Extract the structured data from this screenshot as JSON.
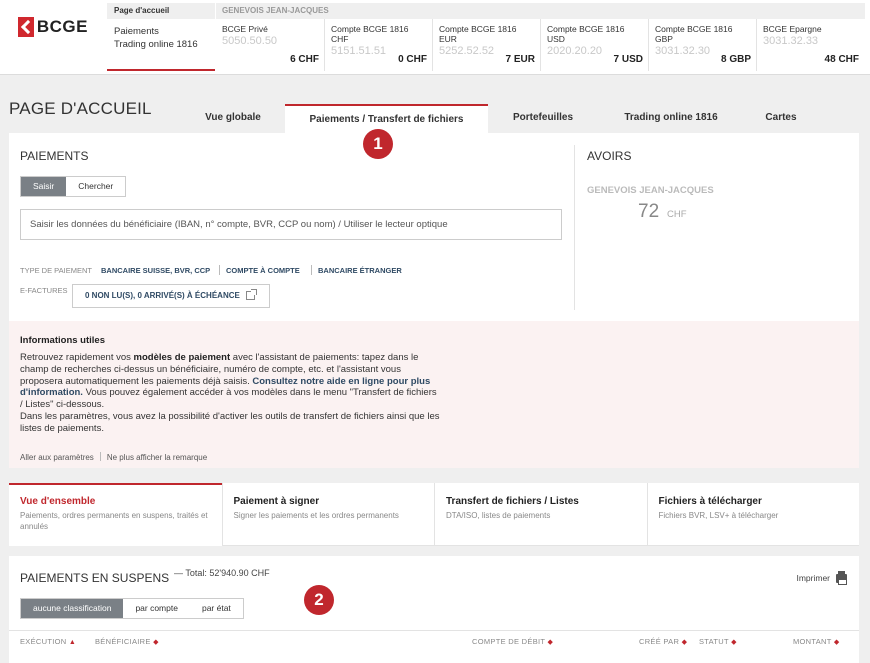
{
  "header": {
    "logo_text": "BCGE",
    "home": {
      "label": "Page d'accueil",
      "line1": "Paiements",
      "line2": "Trading online 1816"
    },
    "owner": "GENEVOIS JEAN-JACQUES",
    "accounts": [
      {
        "name": "BCGE Privé",
        "number": "5050.50.50",
        "amount": "6 CHF"
      },
      {
        "name": "Compte BCGE 1816 CHF",
        "number": "5151.51.51",
        "amount": "0 CHF"
      },
      {
        "name": "Compte BCGE 1816 EUR",
        "number": "5252.52.52",
        "amount": "7 EUR"
      },
      {
        "name": "Compte BCGE 1816 USD",
        "number": "2020.20.20",
        "amount": "7 USD"
      },
      {
        "name": "Compte BCGE 1816 GBP",
        "number": "3031.32.30",
        "amount": "8 GBP"
      },
      {
        "name": "BCGE Epargne",
        "number": "3031.32.33",
        "amount": "48 CHF"
      }
    ]
  },
  "page": {
    "title": "PAGE D'ACCUEIL"
  },
  "tabs": [
    {
      "label": "Vue globale"
    },
    {
      "label": "Paiements / Transfert de fichiers"
    },
    {
      "label": "Portefeuilles"
    },
    {
      "label": "Trading online 1816"
    },
    {
      "label": "Cartes"
    }
  ],
  "badges": {
    "one": "1",
    "two": "2"
  },
  "payments": {
    "title": "PAIEMENTS",
    "btn_enter": "Saisir",
    "btn_search": "Chercher",
    "search_placeholder": "Saisir les données du bénéficiaire (IBAN, n° compte, BVR, CCP ou nom) / Utiliser le lecteur optique",
    "type_label": "TYPE DE PAIEMENT",
    "types": [
      "BANCAIRE SUISSE, BVR, CCP",
      "COMPTE À COMPTE",
      "BANCAIRE ÉTRANGER"
    ],
    "efactures_label": "E-FACTURES",
    "efactures_btn": "0 NON LU(S), 0 ARRIVÉ(S) À ÉCHÉANCE"
  },
  "avoirs": {
    "title": "AVOIRS",
    "name": "GENEVOIS JEAN-JACQUES",
    "value": "72",
    "currency": "CHF"
  },
  "info": {
    "title": "Informations utiles",
    "p1": "Retrouvez rapidement vos ",
    "p1_bold": "modèles de paiement",
    "p2": " avec l'assistant de paiements: tapez dans le champ de recherches ci-dessus un bénéficiaire, numéro de compte, etc. et l'assistant vous proposera automatiquement les paiements déjà saisis. ",
    "p2_link": "Consultez notre aide en ligne pour plus d'information.",
    "p3": " Vous pouvez également accéder à vos modèles dans le menu \"Transfert de fichiers / Listes\" ci-dessous.",
    "p4": "Dans les paramètres, vous avez la possibilité d'activer les outils de transfert de fichiers ainsi que les listes de paiements.",
    "link_settings": "Aller aux paramètres",
    "link_hide": "Ne plus afficher la remarque"
  },
  "subtabs": [
    {
      "title": "Vue d'ensemble",
      "desc": "Paiements, ordres permanents en suspens, traités et annulés"
    },
    {
      "title": "Paiement à signer",
      "desc": "Signer les paiements et les ordres permanents"
    },
    {
      "title": "Transfert de fichiers / Listes",
      "desc": "DTA/ISO, listes de paiements"
    },
    {
      "title": "Fichiers à télécharger",
      "desc": "Fichiers BVR, LSV+ à télécharger"
    }
  ],
  "pending": {
    "title": "PAIEMENTS EN SUSPENS",
    "total": "— Total: 52'940.90 CHF",
    "print": "Imprimer",
    "filters": [
      "aucune classification",
      "par compte",
      "par état"
    ],
    "columns": [
      "EXÉCUTION",
      "BÉNÉFICIAIRE",
      "COMPTE DE DÉBIT",
      "CRÉÉ PAR",
      "STATUT",
      "MONTANT"
    ]
  },
  "colors": {
    "accent": "#c0272d",
    "link": "#2f4a64",
    "segment_active": "#7a8086"
  }
}
